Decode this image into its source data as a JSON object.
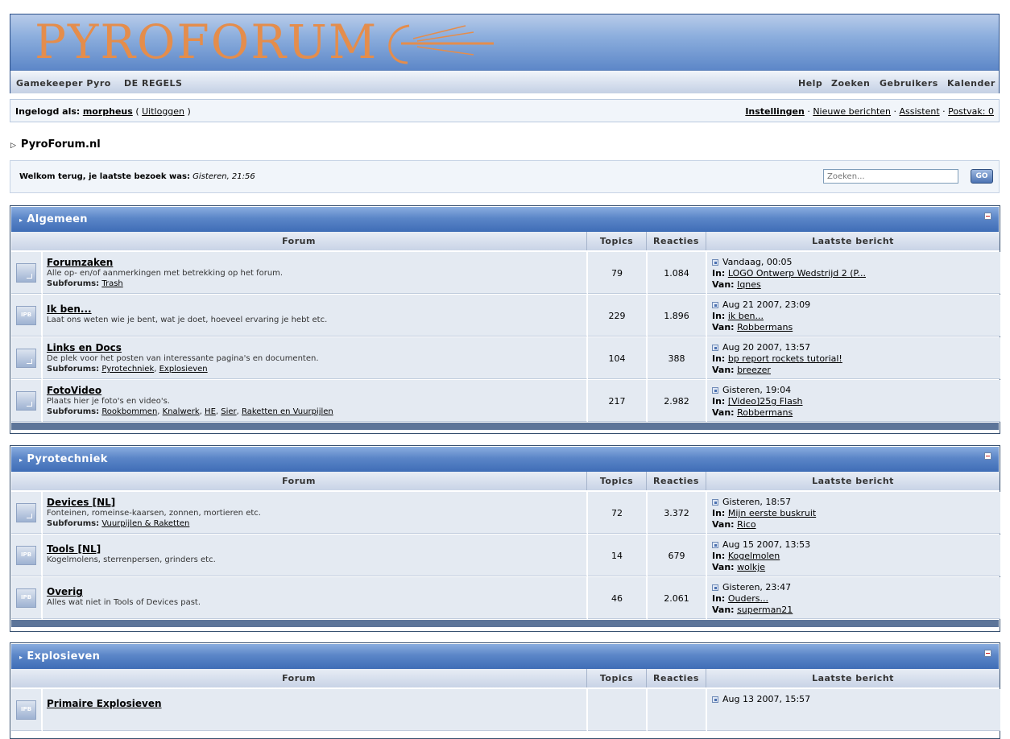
{
  "header": {
    "logo_text": "PYROFORUM",
    "nav_left": [
      "Gamekeeper Pyro",
      "DE REGELS"
    ],
    "nav_right": [
      "Help",
      "Zoeken",
      "Gebruikers",
      "Kalender"
    ]
  },
  "userbar": {
    "logged_in_label": "Ingelogd als:",
    "username": "morpheus",
    "logout": "Uitloggen",
    "links": [
      "Instellingen",
      "Nieuwe berichten",
      "Assistent",
      "Postvak: 0"
    ]
  },
  "breadcrumb": "PyroForum.nl",
  "welcome": {
    "text": "Welkom terug, je laatste bezoek was:",
    "last_visit": "Gisteren, 21:56",
    "search_placeholder": "Zoeken...",
    "go_label": "GO"
  },
  "columns": {
    "forum": "Forum",
    "topics": "Topics",
    "reactions": "Reacties",
    "last": "Laatste bericht"
  },
  "labels": {
    "subforums": "Subforums:",
    "in": "In:",
    "van": "Van:"
  },
  "categories": [
    {
      "title": "Algemeen",
      "forums": [
        {
          "icon": "folder",
          "title": "Forumzaken",
          "desc": "Alle op- en/of aanmerkingen met betrekking op het forum.",
          "subforums": [
            "Trash"
          ],
          "topics": "79",
          "reactions": "1.084",
          "last_date": "Vandaag, 00:05",
          "last_in": "LOGO Ontwerp Wedstrijd 2 (P...",
          "last_by": "Iqnes"
        },
        {
          "icon": "ipb",
          "title": "Ik ben...",
          "desc": "Laat ons weten wie je bent, wat je doet, hoeveel ervaring je hebt etc.",
          "subforums": [],
          "topics": "229",
          "reactions": "1.896",
          "last_date": "Aug 21 2007, 23:09",
          "last_in": "ik ben...",
          "last_by": "Robbermans"
        },
        {
          "icon": "folder",
          "title": "Links en Docs",
          "desc": "De plek voor het posten van interessante pagina's en documenten.",
          "subforums": [
            "Pyrotechniek",
            "Explosieven"
          ],
          "topics": "104",
          "reactions": "388",
          "last_date": "Aug 20 2007, 13:57",
          "last_in": "bp report rockets tutorial!",
          "last_by": "breezer"
        },
        {
          "icon": "folder",
          "title": "FotoVideo",
          "desc": "Plaats hier je foto's en video's.",
          "subforums": [
            "Rookbommen",
            "Knalwerk",
            "HE",
            "Sier",
            "Raketten en Vuurpijlen"
          ],
          "topics": "217",
          "reactions": "2.982",
          "last_date": "Gisteren, 19:04",
          "last_in": "[Video]25g Flash",
          "last_by": "Robbermans"
        }
      ]
    },
    {
      "title": "Pyrotechniek",
      "forums": [
        {
          "icon": "folder",
          "title": "Devices [NL]",
          "desc": "Fonteinen, romeinse-kaarsen, zonnen, mortieren etc.",
          "subforums": [
            "Vuurpijlen & Raketten"
          ],
          "topics": "72",
          "reactions": "3.372",
          "last_date": "Gisteren, 18:57",
          "last_in": "Mijn eerste buskruit",
          "last_by": "Rico"
        },
        {
          "icon": "ipb",
          "title": "Tools [NL]",
          "desc": "Kogelmolens, sterrenpersen, grinders etc.",
          "subforums": [],
          "topics": "14",
          "reactions": "679",
          "last_date": "Aug 15 2007, 13:53",
          "last_in": "Kogelmolen",
          "last_by": "wolkje"
        },
        {
          "icon": "ipb",
          "title": "Overig",
          "desc": "Alles wat niet in Tools of Devices past.",
          "subforums": [],
          "topics": "46",
          "reactions": "2.061",
          "last_date": "Gisteren, 23:47",
          "last_in": "Ouders...",
          "last_by": "superman21"
        }
      ]
    },
    {
      "title": "Explosieven",
      "forums": [
        {
          "icon": "ipb",
          "title": "Primaire Explosieven",
          "desc": "",
          "subforums": [],
          "topics": "",
          "reactions": "",
          "last_date": "Aug 13 2007, 15:57",
          "last_in": "",
          "last_by": ""
        }
      ]
    }
  ],
  "colors": {
    "accent": "#4f7cc0",
    "row_bg": "#e4eaf2",
    "logo_text": "#e48d4c"
  }
}
